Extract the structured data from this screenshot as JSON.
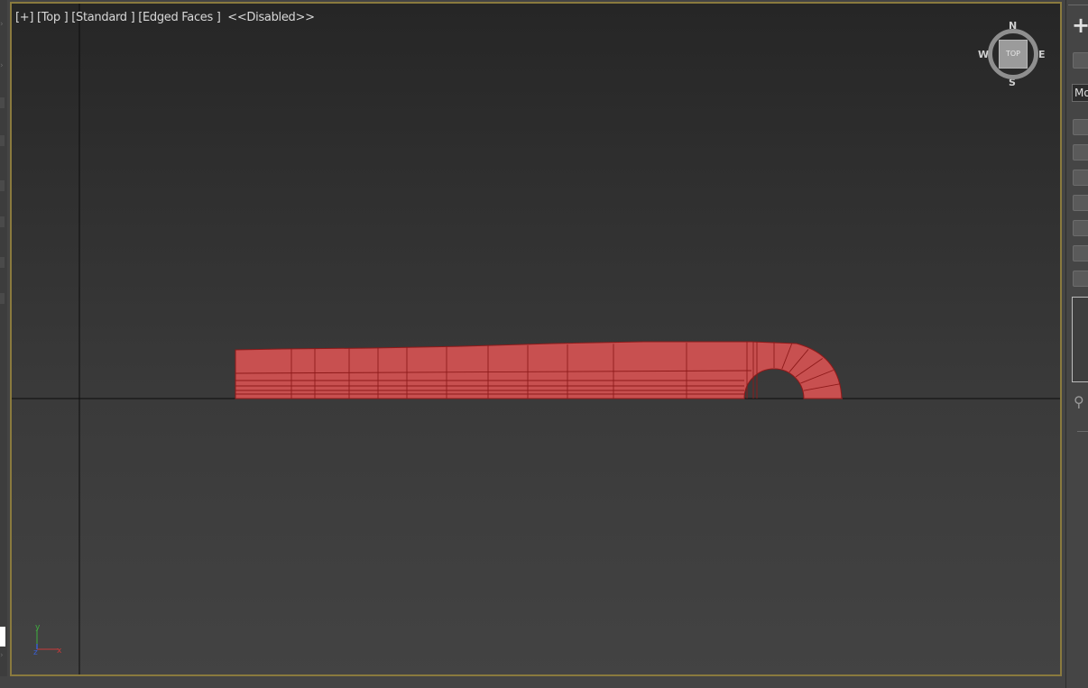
{
  "viewport": {
    "label_plus": "[+]",
    "label_view": "[Top ]",
    "label_shading": "[Standard ]",
    "label_edges": "[Edged Faces ]",
    "label_status": "<<Disabled>>",
    "border_color": "#8a7a3e",
    "mesh_color": "#c85050",
    "mesh_edge_color": "#8e1a1a"
  },
  "viewcube": {
    "north": "N",
    "south": "S",
    "east": "E",
    "west": "W",
    "face_label": "TOP"
  },
  "axis_tripod": {
    "y_label": "y",
    "z_label": "z",
    "x_label": "x"
  },
  "command_panel": {
    "create_icon": "plus-icon",
    "modifier_list_text": "Mo"
  }
}
